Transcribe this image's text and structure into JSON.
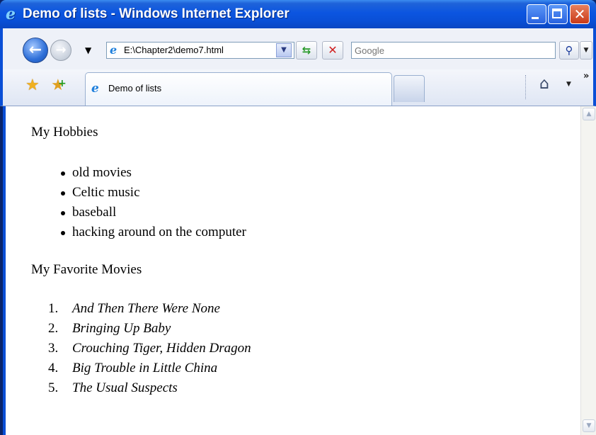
{
  "window": {
    "title": "Demo of lists - Windows Internet Explorer",
    "colors": {
      "titlebar": "#0b55e0",
      "close": "#c93a18"
    }
  },
  "nav": {
    "address": "E:\\Chapter2\\demo7.html",
    "search_placeholder": "Google",
    "icons": [
      "back-arrow-icon",
      "forward-arrow-icon",
      "ie-logo-icon",
      "refresh-icon",
      "stop-icon",
      "search-icon"
    ]
  },
  "tabs": {
    "active_label": "Demo of lists",
    "icons": [
      "favorites-star-icon",
      "add-favorite-icon",
      "home-icon"
    ]
  },
  "document": {
    "hobbies_heading": "My Hobbies",
    "hobbies": [
      "old movies",
      "Celtic music",
      "baseball",
      "hacking around on the computer"
    ],
    "movies_heading": "My Favorite Movies",
    "movies": [
      {
        "num": "1.",
        "title": "And Then There Were None"
      },
      {
        "num": "2.",
        "title": "Bringing Up Baby"
      },
      {
        "num": "3.",
        "title": "Crouching Tiger, Hidden Dragon"
      },
      {
        "num": "4.",
        "title": "Big Trouble in Little China"
      },
      {
        "num": "5.",
        "title": "The Usual Suspects"
      }
    ]
  }
}
